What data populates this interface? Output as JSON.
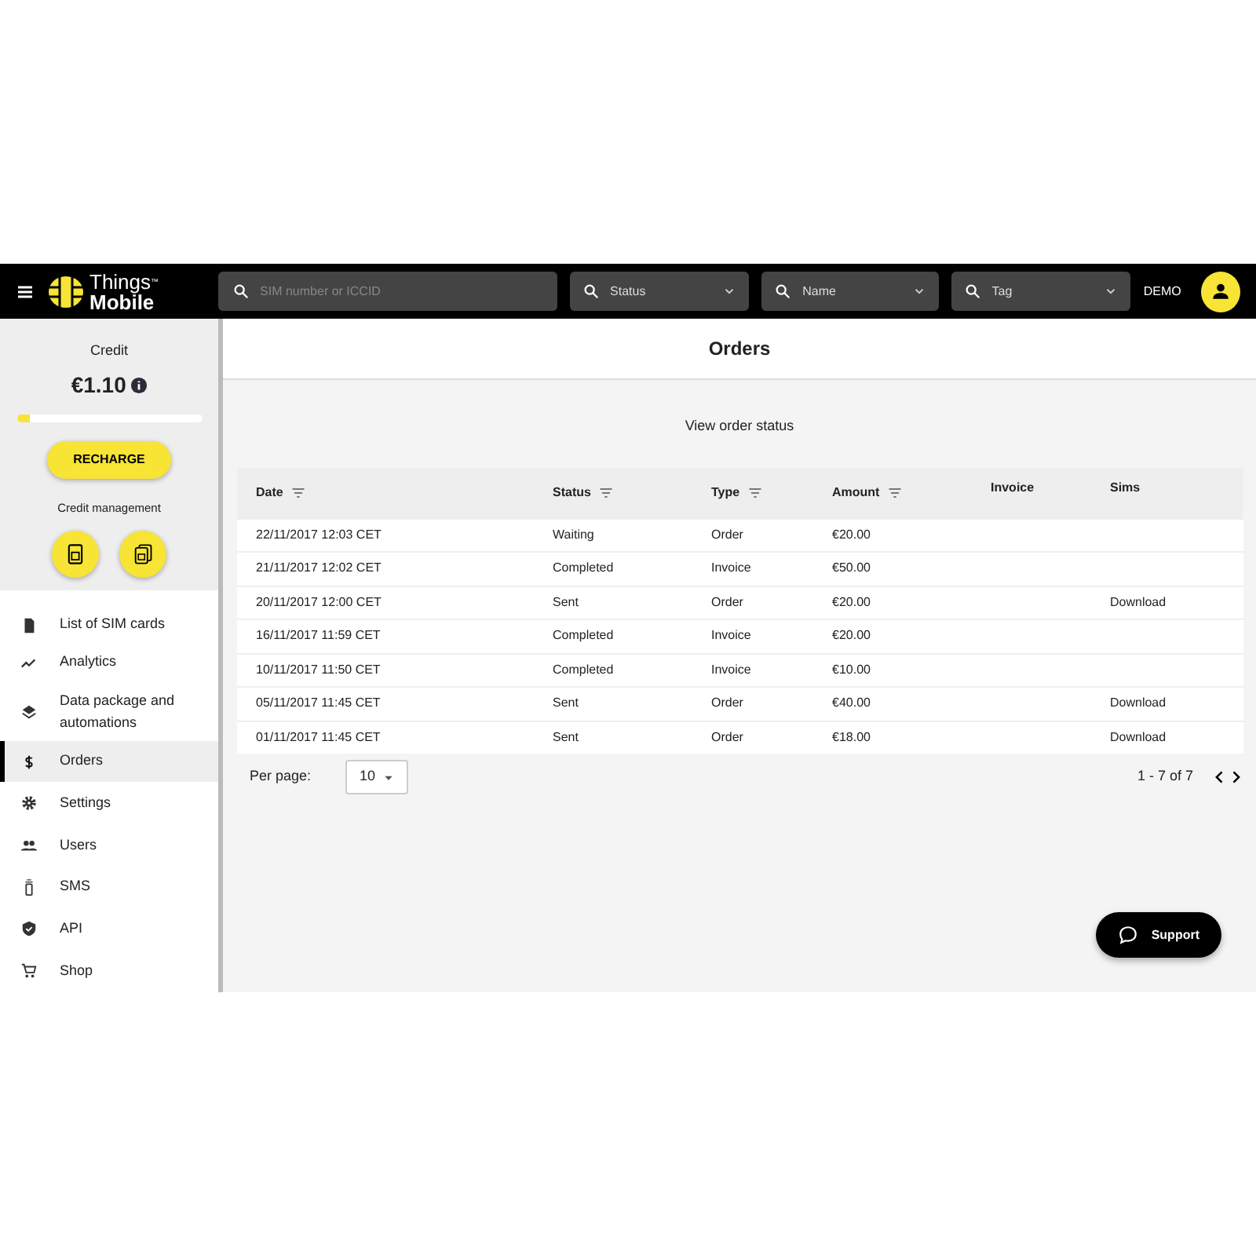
{
  "topbar": {
    "logo_line1": "Things",
    "logo_tm": "™",
    "logo_line2": "Mobile",
    "search": {
      "placeholder": "SIM number or ICCID"
    },
    "filters": [
      {
        "label": "Status"
      },
      {
        "label": "Name"
      },
      {
        "label": "Tag"
      }
    ],
    "user": "DEMO"
  },
  "sidebar": {
    "credit_label": "Credit",
    "credit": "€1.10",
    "credit_bar": {
      "level": 0.07
    },
    "recharge": "RECHARGE",
    "credit_management": "Credit management",
    "items": [
      {
        "label": "List of SIM cards",
        "selected": false
      },
      {
        "label": "Analytics",
        "selected": false
      },
      {
        "label": "Data package and automations",
        "selected": false
      },
      {
        "label": "Orders",
        "selected": true
      },
      {
        "label": "Settings",
        "selected": false
      },
      {
        "label": "Users",
        "selected": false
      },
      {
        "label": "SMS",
        "selected": false
      },
      {
        "label": "API",
        "selected": false
      },
      {
        "label": "Shop",
        "selected": false
      }
    ]
  },
  "page": {
    "title": "Orders",
    "subtitle": "View order status"
  },
  "table": {
    "columns": [
      {
        "label": "Date",
        "filter": true
      },
      {
        "label": "Status",
        "filter": true
      },
      {
        "label": "Type",
        "filter": true
      },
      {
        "label": "Amount",
        "filter": true
      },
      {
        "label": "Invoice",
        "filter": false
      },
      {
        "label": "Sims",
        "filter": false
      }
    ],
    "rows": [
      {
        "date": "22/11/2017 12:03 CET",
        "status": "Waiting",
        "type": "Order",
        "amount": "€20.00"
      },
      {
        "date": "21/11/2017 12:02 CET",
        "status": "Completed",
        "type": "Invoice",
        "amount": "€50.00"
      },
      {
        "date": "20/11/2017 12:00 CET",
        "status": "Sent",
        "type": "Order",
        "amount": "€20.00",
        "sims": "Download"
      },
      {
        "date": "16/11/2017 11:59 CET",
        "status": "Completed",
        "type": "Invoice",
        "amount": "€20.00"
      },
      {
        "date": "10/11/2017 11:50 CET",
        "status": "Completed",
        "type": "Invoice",
        "amount": "€10.00"
      },
      {
        "date": "05/11/2017 11:45 CET",
        "status": "Sent",
        "type": "Order",
        "amount": "€40.00",
        "sims": "Download"
      },
      {
        "date": "01/11/2017 11:45 CET",
        "status": "Sent",
        "type": "Order",
        "amount": "€18.00",
        "sims": "Download"
      }
    ]
  },
  "pagination": {
    "per_page_label": "Per page:",
    "per_page": "10",
    "range": "1 - 7 of 7"
  },
  "support": "Support"
}
